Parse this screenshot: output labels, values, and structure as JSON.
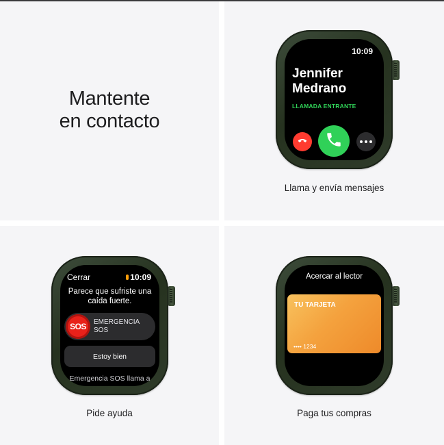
{
  "tiles": {
    "contact": {
      "headline_line1": "Mantente",
      "headline_line2": "en contacto"
    },
    "calls": {
      "caption": "Llama y envía mensajes",
      "screen": {
        "time": "10:09",
        "caller_first": "Jennifer",
        "caller_last": "Medrano",
        "status": "LLAMADA ENTRANTE"
      }
    },
    "sos": {
      "caption": "Pide ayuda",
      "screen": {
        "close_label": "Cerrar",
        "time": "10:09",
        "message_line1": "Parece que sufriste una",
        "message_line2": "caída fuerte.",
        "sos_knob": "SOS",
        "sos_label_line1": "EMERGENCIA",
        "sos_label_line2": "SOS",
        "ok_label": "Estoy bien",
        "footer": "Emergencia SOS llama a"
      }
    },
    "pay": {
      "caption": "Paga tus compras",
      "screen": {
        "title": "Acercar al lector",
        "card_name": "TU TARJETA",
        "card_number": "•••• 1234"
      }
    }
  },
  "colors": {
    "tile_bg": "#f5f5f7",
    "accept_green": "#30d158",
    "decline_red": "#ff3b30",
    "sos_red": "#e8211a",
    "card_orange": "#f4a23e",
    "case_green": "#2f3b2a"
  },
  "icons": [
    "decline-phone-icon",
    "accept-phone-icon",
    "more-icon",
    "microphone-icon"
  ]
}
